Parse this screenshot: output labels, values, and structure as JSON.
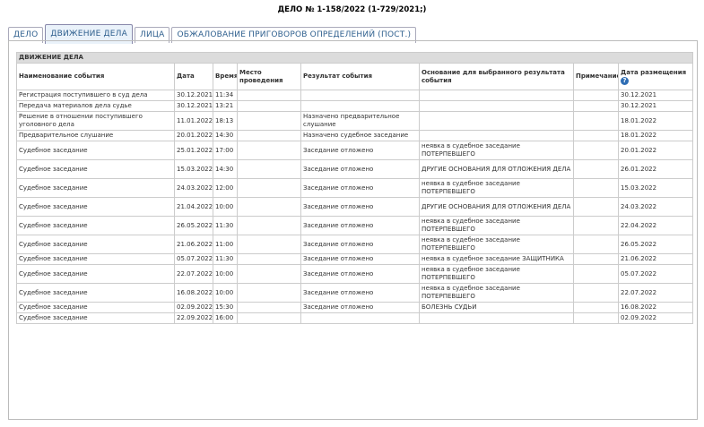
{
  "case_title": "ДЕЛО № 1-158/2022 (1-729/2021;)",
  "tabs": [
    {
      "label": "ДЕЛО",
      "active": false
    },
    {
      "label": "ДВИЖЕНИЕ ДЕЛА",
      "active": true
    },
    {
      "label": "ЛИЦА",
      "active": false
    },
    {
      "label": "ОБЖАЛОВАНИЕ ПРИГОВОРОВ ОПРЕДЕЛЕНИЙ (ПОСТ.)",
      "active": false
    }
  ],
  "section_title": "ДВИЖЕНИЕ ДЕЛА",
  "columns": [
    "Наименование события",
    "Дата",
    "Время",
    "Место проведения",
    "Результат события",
    "Основание для выбранного результата события",
    "Примечание",
    "Дата размещения"
  ],
  "help_icon": "question-icon",
  "rows": [
    {
      "event": "Регистрация поступившего в суд дела",
      "date": "30.12.2021",
      "time": "11:34",
      "place": "",
      "result": "",
      "reason": "",
      "note": "",
      "posted": "30.12.2021"
    },
    {
      "event": "Передача материалов дела судье",
      "date": "30.12.2021",
      "time": "13:21",
      "place": "",
      "result": "",
      "reason": "",
      "note": "",
      "posted": "30.12.2021"
    },
    {
      "event": "Решение в отношении поступившего уголовного дела",
      "date": "11.01.2022",
      "time": "18:13",
      "place": "",
      "result": "Назначено предварительное слушание",
      "reason": "",
      "note": "",
      "posted": "18.01.2022"
    },
    {
      "event": "Предварительное слушание",
      "date": "20.01.2022",
      "time": "14:30",
      "place": "",
      "result": "Назначено судебное заседание",
      "reason": "",
      "note": "",
      "posted": "18.01.2022"
    },
    {
      "event": "Судебное заседание",
      "date": "25.01.2022",
      "time": "17:00",
      "place": "",
      "result": "Заседание отложено",
      "reason": "неявка в судебное заседание ПОТЕРПЕВШЕГО",
      "note": "",
      "posted": "20.01.2022"
    },
    {
      "event": "Судебное заседание",
      "date": "15.03.2022",
      "time": "14:30",
      "place": "",
      "result": "Заседание отложено",
      "reason": "ДРУГИЕ ОСНОВАНИЯ ДЛЯ ОТЛОЖЕНИЯ ДЕЛА",
      "note": "",
      "posted": "26.01.2022"
    },
    {
      "event": "Судебное заседание",
      "date": "24.03.2022",
      "time": "12:00",
      "place": "",
      "result": "Заседание отложено",
      "reason": "неявка в судебное заседание ПОТЕРПЕВШЕГО",
      "note": "",
      "posted": "15.03.2022"
    },
    {
      "event": "Судебное заседание",
      "date": "21.04.2022",
      "time": "10:00",
      "place": "",
      "result": "Заседание отложено",
      "reason": "ДРУГИЕ ОСНОВАНИЯ ДЛЯ ОТЛОЖЕНИЯ ДЕЛА",
      "note": "",
      "posted": "24.03.2022"
    },
    {
      "event": "Судебное заседание",
      "date": "26.05.2022",
      "time": "11:30",
      "place": "",
      "result": "Заседание отложено",
      "reason": "неявка в судебное заседание ПОТЕРПЕВШЕГО",
      "note": "",
      "posted": "22.04.2022"
    },
    {
      "event": "Судебное заседание",
      "date": "21.06.2022",
      "time": "11:00",
      "place": "",
      "result": "Заседание отложено",
      "reason": "неявка в судебное заседание ПОТЕРПЕВШЕГО",
      "note": "",
      "posted": "26.05.2022"
    },
    {
      "event": "Судебное заседание",
      "date": "05.07.2022",
      "time": "11:30",
      "place": "",
      "result": "Заседание отложено",
      "reason": "неявка в судебное заседание ЗАЩИТНИКА",
      "note": "",
      "posted": "21.06.2022"
    },
    {
      "event": "Судебное заседание",
      "date": "22.07.2022",
      "time": "10:00",
      "place": "",
      "result": "Заседание отложено",
      "reason": "неявка в судебное заседание ПОТЕРПЕВШЕГО",
      "note": "",
      "posted": "05.07.2022"
    },
    {
      "event": "Судебное заседание",
      "date": "16.08.2022",
      "time": "10:00",
      "place": "",
      "result": "Заседание отложено",
      "reason": "неявка в судебное заседание ПОТЕРПЕВШЕГО",
      "note": "",
      "posted": "22.07.2022"
    },
    {
      "event": "Судебное заседание",
      "date": "02.09.2022",
      "time": "15:30",
      "place": "",
      "result": "Заседание отложено",
      "reason": "БОЛЕЗНЬ СУДЬИ",
      "note": "",
      "posted": "16.08.2022"
    },
    {
      "event": "Судебное заседание",
      "date": "22.09.2022",
      "time": "16:00",
      "place": "",
      "result": "",
      "reason": "",
      "note": "",
      "posted": "02.09.2022"
    }
  ]
}
